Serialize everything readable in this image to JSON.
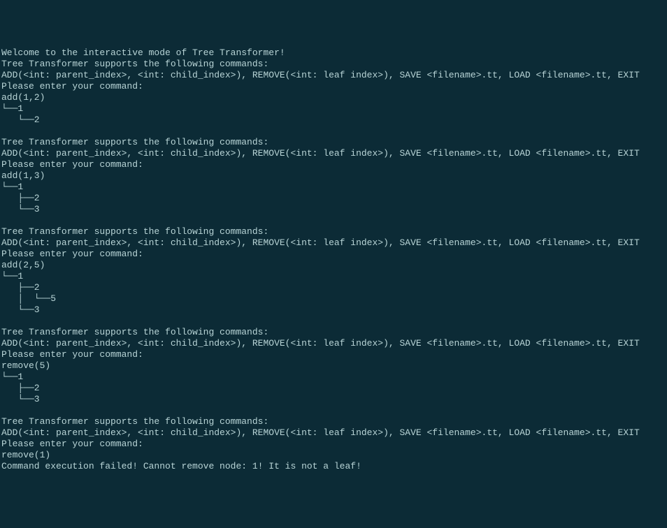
{
  "lines": [
    "Welcome to the interactive mode of Tree Transformer!",
    "Tree Transformer supports the following commands:",
    "ADD(<int: parent_index>, <int: child_index>), REMOVE(<int: leaf index>), SAVE <filename>.tt, LOAD <filename>.tt, EXIT",
    "Please enter your command:",
    "add(1,2)",
    "└──1",
    "   └──2",
    "",
    "Tree Transformer supports the following commands:",
    "ADD(<int: parent_index>, <int: child_index>), REMOVE(<int: leaf index>), SAVE <filename>.tt, LOAD <filename>.tt, EXIT",
    "Please enter your command:",
    "add(1,3)",
    "└──1",
    "   ├──2",
    "   └──3",
    "",
    "Tree Transformer supports the following commands:",
    "ADD(<int: parent_index>, <int: child_index>), REMOVE(<int: leaf index>), SAVE <filename>.tt, LOAD <filename>.tt, EXIT",
    "Please enter your command:",
    "add(2,5)",
    "└──1",
    "   ├──2",
    "   │  └──5",
    "   └──3",
    "",
    "Tree Transformer supports the following commands:",
    "ADD(<int: parent_index>, <int: child_index>), REMOVE(<int: leaf index>), SAVE <filename>.tt, LOAD <filename>.tt, EXIT",
    "Please enter your command:",
    "remove(5)",
    "└──1",
    "   ├──2",
    "   └──3",
    "",
    "Tree Transformer supports the following commands:",
    "ADD(<int: parent_index>, <int: child_index>), REMOVE(<int: leaf index>), SAVE <filename>.tt, LOAD <filename>.tt, EXIT",
    "Please enter your command:",
    "remove(1)",
    "Command execution failed! Cannot remove node: 1! It is not a leaf!"
  ]
}
